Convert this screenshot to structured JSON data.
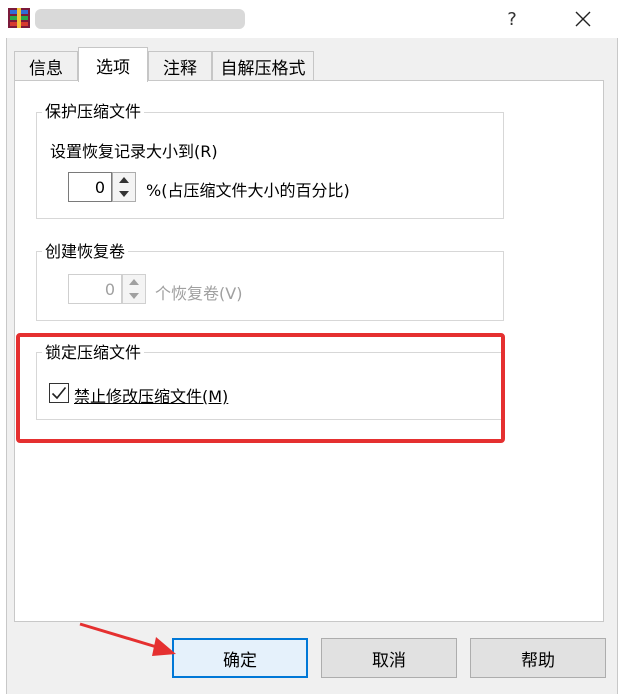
{
  "titlebar": {
    "help_label": "?",
    "close_label": "✕"
  },
  "tabs": [
    {
      "label": "信息"
    },
    {
      "label": "选项"
    },
    {
      "label": "注释"
    },
    {
      "label": "自解压格式"
    }
  ],
  "protect": {
    "title": "保护压缩文件",
    "setting_label": "设置恢复记录大小到(R)",
    "value": "0",
    "unit_label": "%(占压缩文件大小的百分比)"
  },
  "recovery": {
    "title": "创建恢复卷",
    "value": "0",
    "unit_label": "个恢复卷(V)"
  },
  "lock": {
    "title": "锁定压缩文件",
    "checkbox_label": "禁止修改压缩文件(M)",
    "checked": true
  },
  "buttons": {
    "ok": "确定",
    "cancel": "取消",
    "help": "帮助"
  },
  "colors": {
    "highlight": "#e53030",
    "focus_border": "#0078d7"
  }
}
